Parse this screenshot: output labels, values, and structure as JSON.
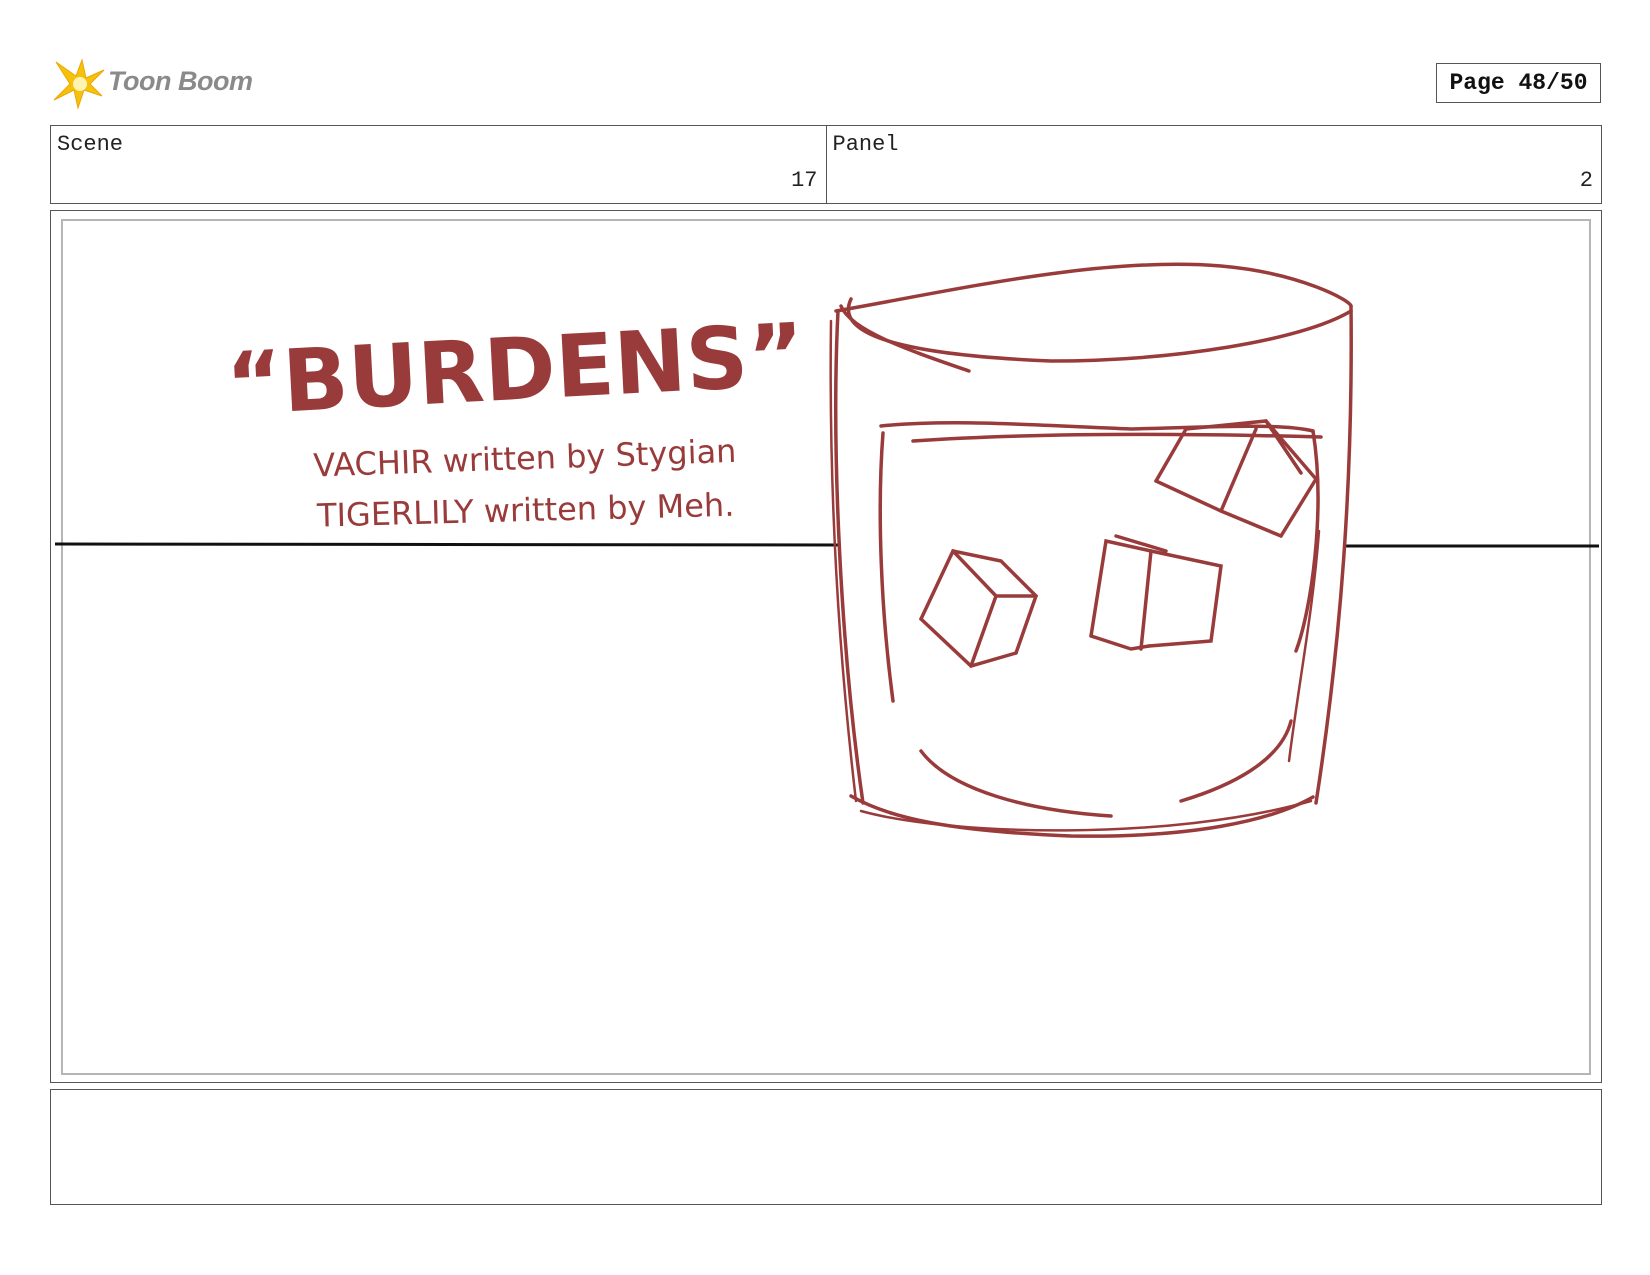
{
  "header": {
    "logo_text": "Toon Boom",
    "page_label": "Page 48/50"
  },
  "scene": {
    "label": "Scene",
    "value": "17"
  },
  "panel": {
    "label": "Panel",
    "value": "2"
  },
  "artwork": {
    "title": "“BURDENS”",
    "credit_line_1": "VACHIR written by Stygian",
    "credit_line_2": "TIGERLILY written by Meh.",
    "sketch_color": "#9a3b3b"
  },
  "notes": {
    "text": ""
  }
}
